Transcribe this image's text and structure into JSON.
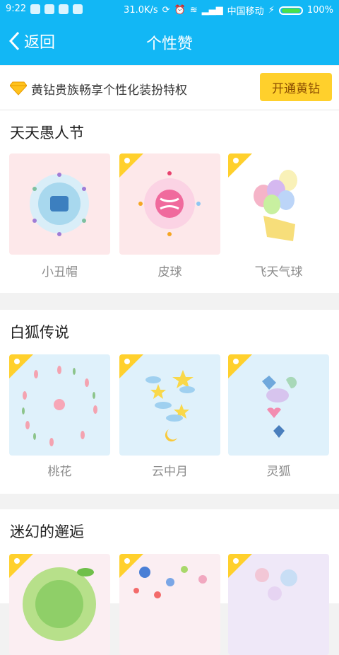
{
  "status": {
    "time": "9:22",
    "speed": "31.0K/s",
    "carrier": "中国移动",
    "battery": "100%"
  },
  "nav": {
    "back_label": "返回",
    "title": "个性赞"
  },
  "promo": {
    "text": "黄钻贵族畅享个性化装扮特权",
    "button": "开通黄钻"
  },
  "sections": [
    {
      "title": "天天愚人节",
      "items": [
        {
          "label": "小丑帽"
        },
        {
          "label": "皮球"
        },
        {
          "label": "飞天气球"
        }
      ]
    },
    {
      "title": "白狐传说",
      "items": [
        {
          "label": "桃花"
        },
        {
          "label": "云中月"
        },
        {
          "label": "灵狐"
        }
      ]
    },
    {
      "title": "迷幻的邂逅",
      "items": [
        {
          "label": ""
        },
        {
          "label": ""
        },
        {
          "label": ""
        }
      ]
    }
  ],
  "colors": {
    "accent": "#12b7f5",
    "vip": "#ffd02c"
  }
}
